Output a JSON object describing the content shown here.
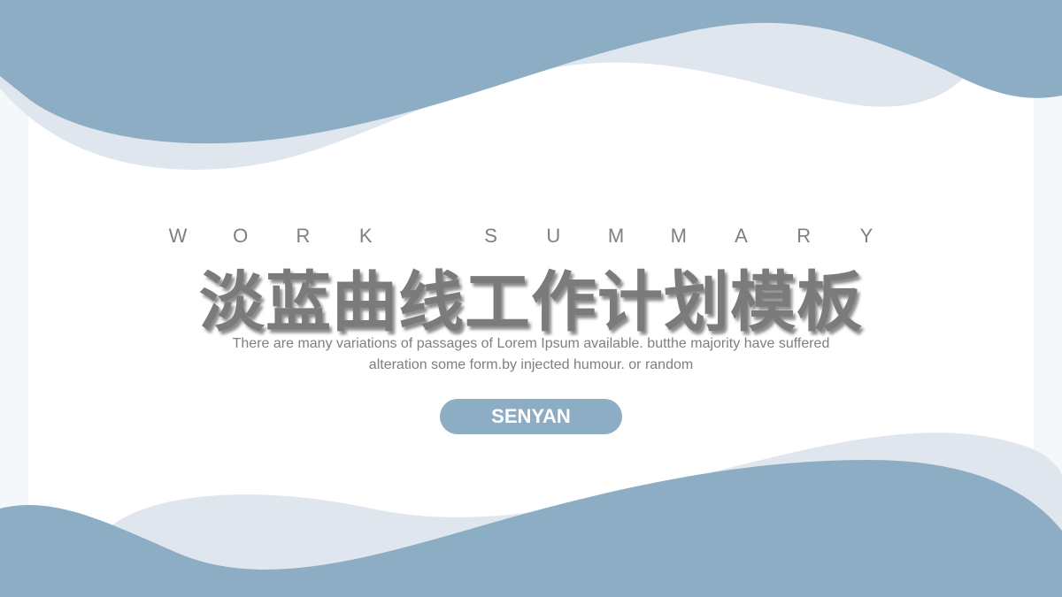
{
  "slide": {
    "header_en": "WORK SUMMARY",
    "header_en_letters": [
      "W",
      "O",
      "R",
      "K",
      "",
      "S",
      "U",
      "M",
      "M",
      "A",
      "R",
      "Y"
    ],
    "title_cn": "淡蓝曲线工作计划模板",
    "description_line1": "There are many variations of passages of Lorem Ipsum available. butthe majority have suffered",
    "description_line2": "alteration some form.by injected humour. or random",
    "button_label": "SENYAN"
  },
  "colors": {
    "wave_dark": "#8dadc4",
    "wave_light": "#dfe6ee",
    "text_gray": "#7f7f7f",
    "background": "#ffffff"
  }
}
